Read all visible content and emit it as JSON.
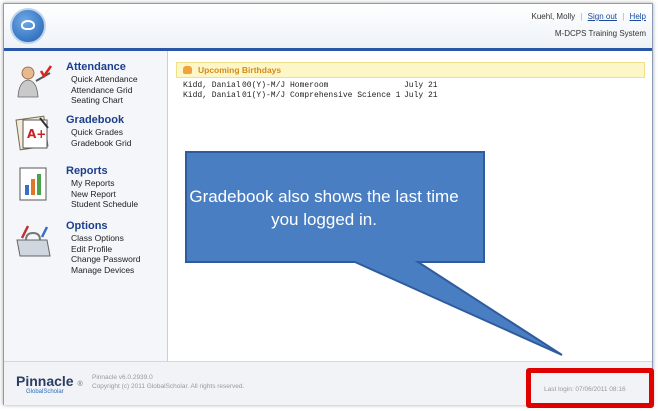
{
  "header": {
    "user_name": "Kuehl, Molly",
    "sign_out": "Sign out",
    "help": "Help",
    "system_name": "M-DCPS Training System"
  },
  "sidebar": {
    "sections": [
      {
        "title": "Attendance",
        "icon": "teacher-attendance-icon",
        "links": [
          "Quick Attendance",
          "Attendance Grid",
          "Seating Chart"
        ]
      },
      {
        "title": "Gradebook",
        "icon": "gradebook-icon",
        "links": [
          "Quick Grades",
          "Gradebook Grid"
        ]
      },
      {
        "title": "Reports",
        "icon": "reports-icon",
        "links": [
          "My Reports",
          "New Report",
          "Student Schedule"
        ]
      },
      {
        "title": "Options",
        "icon": "toolbox-icon",
        "links": [
          "Class Options",
          "Edit Profile",
          "Change Password",
          "Manage Devices"
        ]
      }
    ]
  },
  "birthdays": {
    "title": "Upcoming Birthdays",
    "rows": [
      {
        "name": "Kidd, Danial",
        "class": "00(Y)-M/J Homeroom",
        "date": "July 21"
      },
      {
        "name": "Kidd, Danial",
        "class": "01(Y)-M/J Comprehensive Science 1",
        "date": "July 21"
      }
    ]
  },
  "footer": {
    "brand": "Pinnacle",
    "brand_suffix": "GlobalScholar",
    "version": "Pinnacle v6.0.2939.0",
    "copyright": "Copyright (c) 2011 GlobalScholar. All rights reserved.",
    "last_login": "Last login: 07/06/2011 08:16"
  },
  "callout": {
    "text": "Gradebook also shows the last time you logged in.",
    "color": "#4a7ec2"
  },
  "colors": {
    "accent": "#2a56a8",
    "highlight": "#e00000"
  }
}
